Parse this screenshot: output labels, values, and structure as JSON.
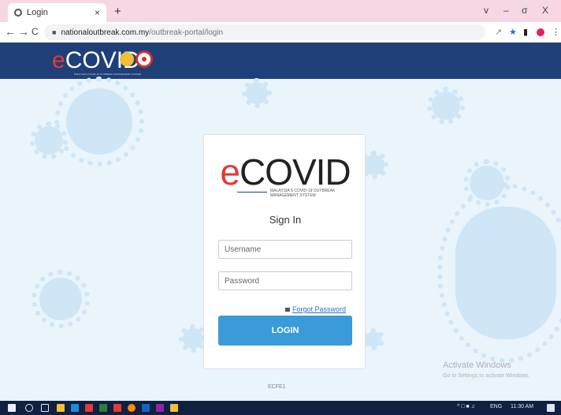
{
  "browser": {
    "tab_title": "Login",
    "tab_close": "×",
    "new_tab": "+",
    "window_controls": [
      "v",
      "–",
      "σ",
      "X"
    ],
    "nav": {
      "back": "←",
      "forward": "→",
      "reload": "C"
    },
    "url_domain": "nationaloutbreak.com.my",
    "url_path": "/outbreak-portal/login"
  },
  "header": {
    "logo_e": "e",
    "logo_rest": "COVID",
    "logo_subtitle": "MALAYSIA'S COVID-19 OUTBREAK MANAGEMENT SYSTEM"
  },
  "login": {
    "logo_e": "e",
    "logo_rest": "COVID",
    "tagline": "MALAYSIA'S COVID-19 OUTBREAK MANAGEMENT SYSTEM",
    "heading": "Sign In",
    "username_placeholder": "Username",
    "password_placeholder": "Password",
    "forgot_password": "Forgot Password",
    "login_button": "LOGIN"
  },
  "footer_code": "ECFE1",
  "watermark": {
    "line1": "Activate Windows",
    "line2": "Go to Settings to activate Windows."
  },
  "taskbar": {
    "tray_language": "ENG",
    "tray_time": "11:30 AM"
  },
  "colors": {
    "header_bg": "#1f3f78",
    "accent_red": "#e53935",
    "button_blue": "#3a9bd8",
    "tab_strip": "#f7d7e4",
    "page_bg": "#eaf4fb"
  }
}
